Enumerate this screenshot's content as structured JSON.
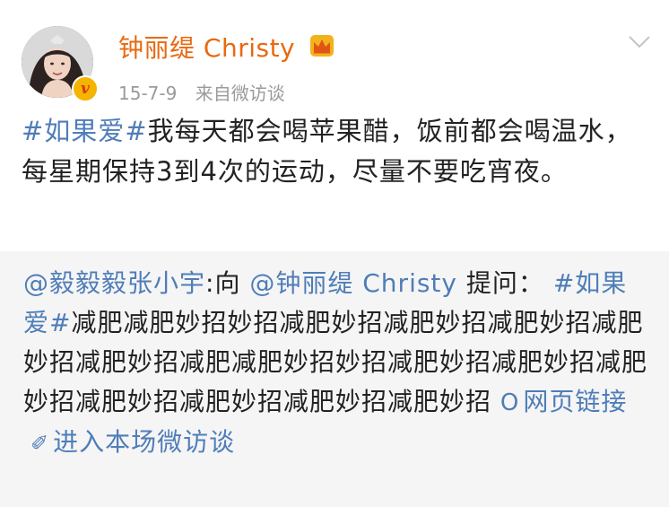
{
  "post": {
    "author": "钟丽缇 Christy",
    "date": "15-7-9",
    "source": "来自微访谈",
    "topic": "#如果爱#",
    "text": "我每天都会喝苹果醋，饭前都会喝温水，每星期保持3到4次的运动，尽量不要吃宵夜。"
  },
  "repost": {
    "mention_user": "@毅毅毅张小宇",
    "to_label": ":向",
    "mention_author": "@钟丽缇 Christy",
    "ask_label": "提问：",
    "topic": "#如果爱#",
    "text": "减肥减肥妙招妙招减肥妙招减肥妙招减肥妙招减肥妙招减肥妙招减肥减肥妙招妙招减肥妙招减肥妙招减肥妙招减肥妙招减肥妙招减肥妙招减肥妙招",
    "web_link_label": "网页链接",
    "enter_label": "进入本场微访谈"
  },
  "icons": {
    "crown": "crown-icon",
    "verified": "verified-badge",
    "chevron": "chevron-down-icon",
    "web_link": "web-link-icon",
    "link": "link-icon"
  },
  "colors": {
    "author": "#e8690f",
    "link": "#4f7db8",
    "meta": "#9a9a9a",
    "repost_bg": "#f5f5f5"
  }
}
